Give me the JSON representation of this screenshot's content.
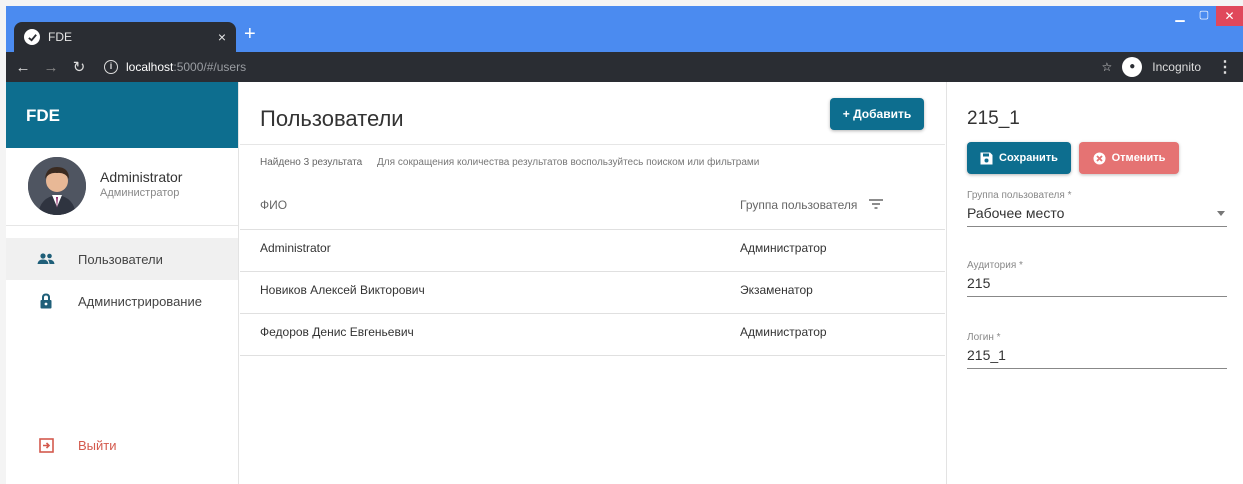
{
  "browser": {
    "tab_title": "FDE",
    "tab_close": "×",
    "new_tab": "+",
    "url_host": "localhost",
    "url_path": ":5000/#/users",
    "mode_label": "Incognito"
  },
  "sidebar": {
    "brand": "FDE",
    "user_name": "Administrator",
    "user_role": "Администратор",
    "items": [
      {
        "label": "Пользователи",
        "icon": "users-icon"
      },
      {
        "label": "Администрирование",
        "icon": "lock-icon"
      }
    ],
    "logout_label": "Выйти"
  },
  "main": {
    "title": "Пользователи",
    "add_button": "+ Добавить",
    "results_count": "Найдено 3 результата",
    "results_hint": "Для сокращения количества результатов воспользуйтесь поиском или фильтрами",
    "columns": {
      "fio": "ФИО",
      "group": "Группа пользователя"
    },
    "rows": [
      {
        "fio": "Administrator",
        "group": "Администратор"
      },
      {
        "fio": "Новиков Алексей Викторович",
        "group": "Экзаменатор"
      },
      {
        "fio": "Федоров Денис Евгеньевич",
        "group": "Администратор"
      }
    ]
  },
  "panel": {
    "title": "215_1",
    "save_button": "Сохранить",
    "cancel_button": "Отменить",
    "fields": {
      "group": {
        "label": "Группа пользователя *",
        "value": "Рабочее место"
      },
      "auditory": {
        "label": "Аудитория *",
        "value": "215"
      },
      "login": {
        "label": "Логин *",
        "value": "215_1"
      }
    }
  },
  "colors": {
    "accent": "#0d6e8f",
    "cancel": "#e57373",
    "logout": "#d45a4e",
    "browser_tabbar": "#4b8bf0"
  }
}
